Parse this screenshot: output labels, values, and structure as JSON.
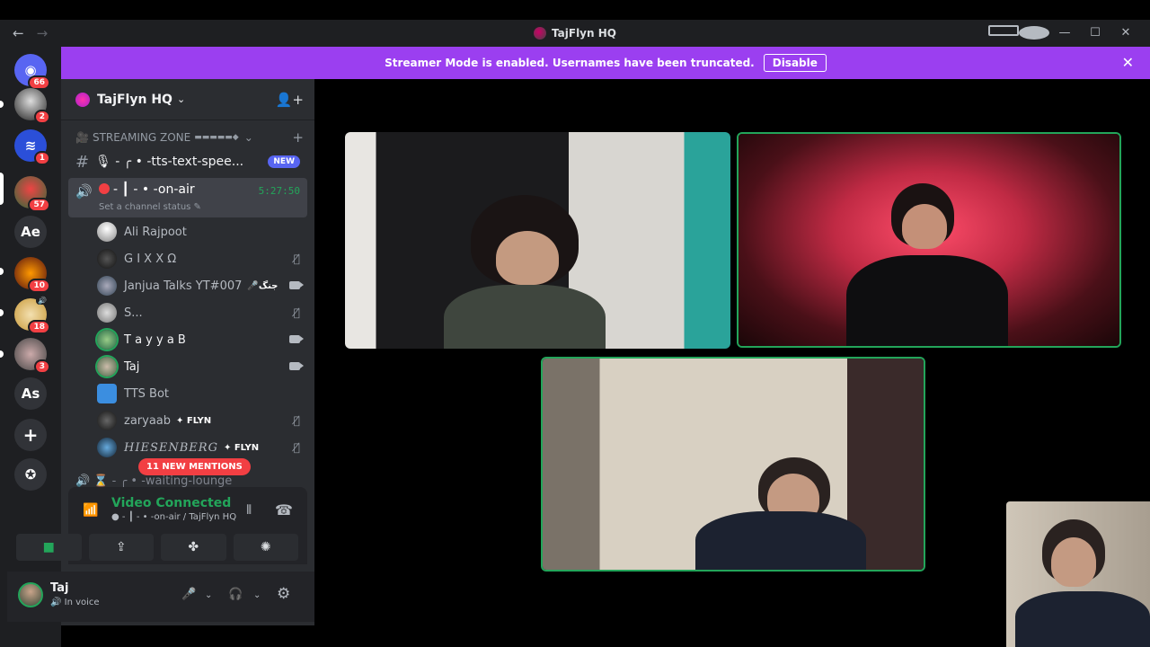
{
  "window": {
    "title": "TajFlyn HQ",
    "nav_back": "←",
    "nav_forward": "→",
    "minimize": "—",
    "maximize": "☐",
    "close": "✕"
  },
  "banner": {
    "text": "Streamer Mode is enabled. Usernames have been truncated.",
    "button": "Disable",
    "close": "✕",
    "color": "#9b3ff0"
  },
  "rail": {
    "servers": [
      {
        "name": "home",
        "badge": "66",
        "color": "#5865f2",
        "glyph": "◉"
      },
      {
        "name": "server-2",
        "badge": "2",
        "color": "#3a3a3a",
        "glyph": ""
      },
      {
        "name": "server-3",
        "badge": "1",
        "color": "#2b4fd9",
        "glyph": "≋"
      },
      {
        "name": "server-4",
        "badge": "57",
        "color": "#2f6b3a",
        "glyph": ""
      },
      {
        "name": "server-ae",
        "badge": "",
        "color": "#313338",
        "glyph": "Ae"
      },
      {
        "name": "server-6",
        "badge": "10",
        "color": "#5a1a1a",
        "glyph": ""
      },
      {
        "name": "server-7",
        "badge": "18",
        "color": "#c99a3a",
        "glyph": ""
      },
      {
        "name": "server-8",
        "badge": "3",
        "color": "#444",
        "glyph": ""
      },
      {
        "name": "server-as",
        "badge": "",
        "color": "#313338",
        "glyph": "As"
      },
      {
        "name": "add-server",
        "badge": "",
        "color": "#313338",
        "glyph": "+"
      },
      {
        "name": "discover",
        "badge": "",
        "color": "#313338",
        "glyph": "✪"
      }
    ]
  },
  "server": {
    "name": "TajFlyn HQ",
    "chevron": "⌄",
    "invite": "👤+"
  },
  "category": {
    "name": "STREAMING ZONE",
    "decor": "▬▬▬▬▬◆",
    "chevron": "⌄",
    "plus": "+"
  },
  "channels": {
    "text_channel": "🎙 - ╭ • -tts-text-spee...",
    "text_hash": "#",
    "new_badge": "NEW",
    "voice_channel": "- ┃ - • -on-air",
    "voice_timer": "5:27:50",
    "voice_status": "Set a channel status ✎",
    "waiting": "🔊 ⌛ - ╭ • -waiting-lounge"
  },
  "members": [
    {
      "name": "Ali Rajpoot",
      "icon": "",
      "tag": "",
      "avatar": "#d8d8d8"
    },
    {
      "name": "G I X X Ω",
      "icon": "mute",
      "tag": "",
      "avatar": "#222"
    },
    {
      "name": "Janjua Talks YT#007",
      "icon": "cam",
      "tag": "🎤جنگ",
      "avatar": "#6b7a8a"
    },
    {
      "name": "S...",
      "icon": "mute",
      "tag": "",
      "avatar": "#9a9a9a"
    },
    {
      "name": "T a y y a B",
      "icon": "cam",
      "tag": "",
      "avatar": "#4a7a5a"
    },
    {
      "name": "Taj",
      "icon": "cam",
      "tag": "",
      "avatar": "#6a8a6a"
    },
    {
      "name": "TTS Bot",
      "icon": "",
      "tag": "",
      "avatar": "#3b8ee0"
    },
    {
      "name": "zaryaab",
      "icon": "mute",
      "tag": "✦ FLYN",
      "avatar": "#333"
    },
    {
      "name": "HIESENBERG",
      "icon": "mute",
      "tag": "✦ FLYN",
      "avatar": "#2a3a4a"
    }
  ],
  "mentions": "11 NEW MENTIONS",
  "rtc": {
    "status": "Video Connected",
    "location": "● - ┃ - • -on-air / TajFlyn HQ",
    "signal_icon": "📶",
    "activity_icon": "⦀",
    "disconnect_icon": "☎",
    "buttons": [
      "■",
      "⇪",
      "✤",
      "✺"
    ]
  },
  "user": {
    "name": "Taj",
    "status": "In voice",
    "mic": "🎤",
    "headset": "🎧",
    "settings": "⚙",
    "chevron": "⌄"
  },
  "videos": [
    {
      "name": "video-tile-1",
      "speaking": false,
      "bg": "#d9d7d2"
    },
    {
      "name": "video-tile-2",
      "speaking": true,
      "bg": "#3a1418"
    },
    {
      "name": "video-tile-3",
      "speaking": true,
      "bg": "#bcb3a4"
    },
    {
      "name": "self-preview",
      "speaking": false,
      "bg": "#bfb6a8"
    }
  ]
}
